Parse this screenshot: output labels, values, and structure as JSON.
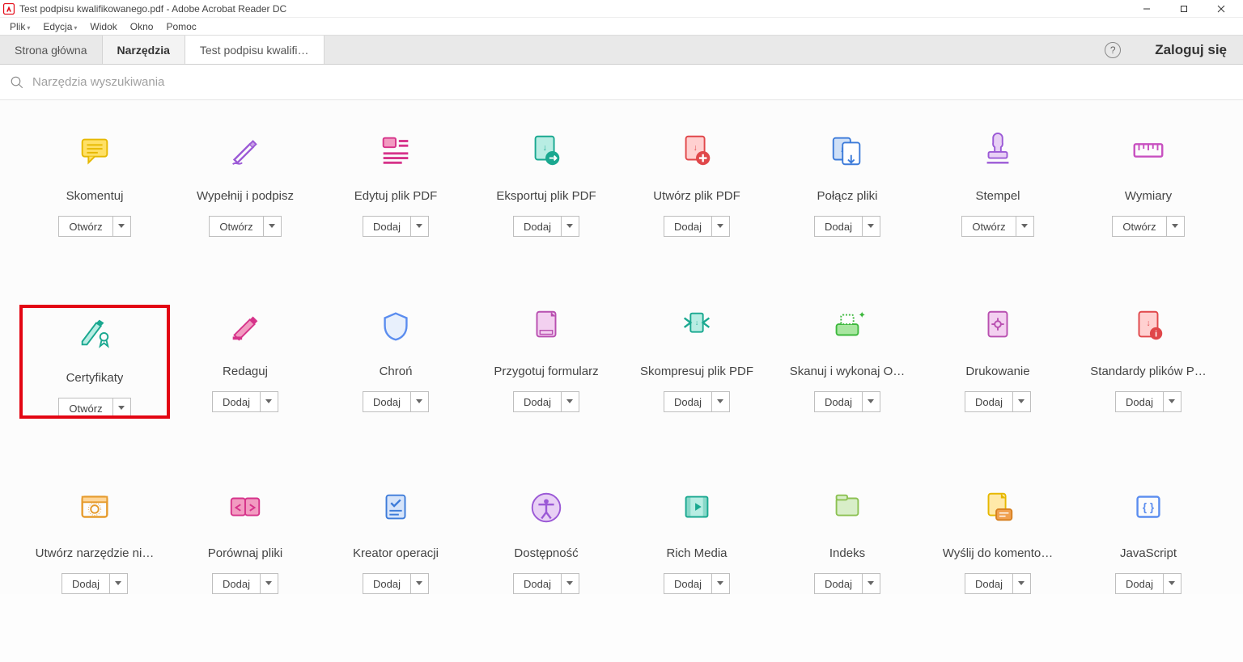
{
  "window": {
    "title": "Test podpisu kwalifikowanego.pdf - Adobe Acrobat Reader DC"
  },
  "menu": {
    "items": [
      "Plik",
      "Edycja",
      "Widok",
      "Okno",
      "Pomoc"
    ]
  },
  "toprow": {
    "home": "Strona główna",
    "tools": "Narzędzia",
    "doc": "Test podpisu kwalifi…",
    "login": "Zaloguj się"
  },
  "search": {
    "placeholder": "Narzędzia wyszukiwania"
  },
  "buttons": {
    "open": "Otwórz",
    "add": "Dodaj"
  },
  "tools": [
    {
      "label": "Skomentuj",
      "action": "open",
      "icon": "comment",
      "highlight": false
    },
    {
      "label": "Wypełnij i podpisz",
      "action": "open",
      "icon": "fillsign",
      "highlight": false
    },
    {
      "label": "Edytuj plik PDF",
      "action": "add",
      "icon": "editpdf",
      "highlight": false
    },
    {
      "label": "Eksportuj plik PDF",
      "action": "add",
      "icon": "export",
      "highlight": false
    },
    {
      "label": "Utwórz plik PDF",
      "action": "add",
      "icon": "create",
      "highlight": false
    },
    {
      "label": "Połącz pliki",
      "action": "add",
      "icon": "combine",
      "highlight": false
    },
    {
      "label": "Stempel",
      "action": "open",
      "icon": "stamp",
      "highlight": false
    },
    {
      "label": "Wymiary",
      "action": "open",
      "icon": "measure",
      "highlight": false
    },
    {
      "label": "Certyfikaty",
      "action": "open",
      "icon": "cert",
      "highlight": true
    },
    {
      "label": "Redaguj",
      "action": "add",
      "icon": "redact",
      "highlight": false
    },
    {
      "label": "Chroń",
      "action": "add",
      "icon": "protect",
      "highlight": false
    },
    {
      "label": "Przygotuj formularz",
      "action": "add",
      "icon": "prepform",
      "highlight": false
    },
    {
      "label": "Skompresuj plik PDF",
      "action": "add",
      "icon": "compress",
      "highlight": false
    },
    {
      "label": "Skanuj i wykonaj O…",
      "action": "add",
      "icon": "scanocr",
      "highlight": false
    },
    {
      "label": "Drukowanie",
      "action": "add",
      "icon": "print",
      "highlight": false
    },
    {
      "label": "Standardy plików P…",
      "action": "add",
      "icon": "standards",
      "highlight": false
    },
    {
      "label": "Utwórz narzędzie ni…",
      "action": "add",
      "icon": "customtool",
      "highlight": false
    },
    {
      "label": "Porównaj pliki",
      "action": "add",
      "icon": "compare",
      "highlight": false
    },
    {
      "label": "Kreator operacji",
      "action": "add",
      "icon": "wizard",
      "highlight": false
    },
    {
      "label": "Dostępność",
      "action": "add",
      "icon": "access",
      "highlight": false
    },
    {
      "label": "Rich Media",
      "action": "add",
      "icon": "richmedia",
      "highlight": false
    },
    {
      "label": "Indeks",
      "action": "add",
      "icon": "index",
      "highlight": false
    },
    {
      "label": "Wyślij do komento…",
      "action": "add",
      "icon": "sendcomm",
      "highlight": false
    },
    {
      "label": "JavaScript",
      "action": "add",
      "icon": "js",
      "highlight": false
    }
  ]
}
